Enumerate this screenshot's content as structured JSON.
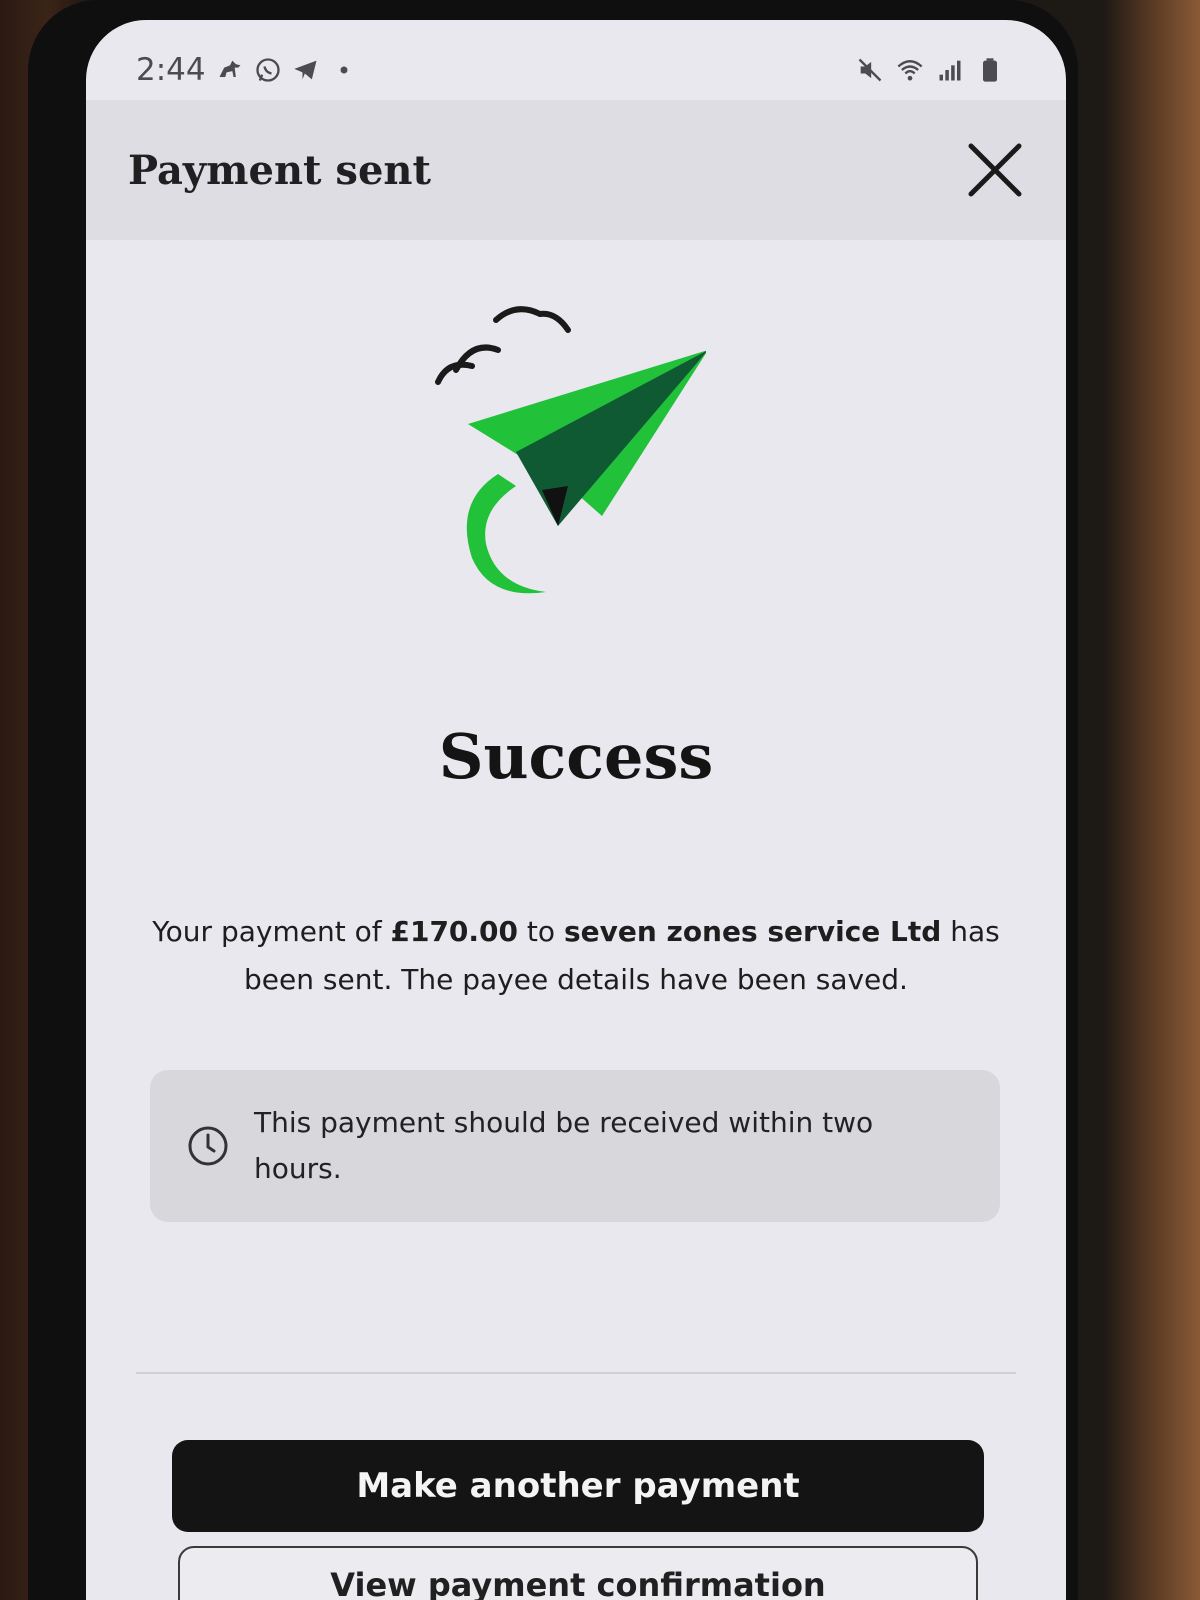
{
  "status_bar": {
    "time": "2:44",
    "left_icons": [
      "horse-icon",
      "whatsapp-icon",
      "telegram-icon",
      "dot-icon"
    ],
    "right_icons": [
      "mute-icon",
      "wifi-icon",
      "signal-icon",
      "battery-icon"
    ]
  },
  "header": {
    "title": "Payment sent",
    "close_icon": "close-icon"
  },
  "hero": {
    "icon": "paper-plane-icon",
    "colors": {
      "plane_light": "#22c13a",
      "plane_dark": "#0f5a32",
      "birds": "#1a1a1a"
    }
  },
  "success": {
    "heading": "Success",
    "message_prefix": "Your payment of ",
    "amount": "£170.00",
    "message_mid": " to ",
    "payee": "seven zones service Ltd",
    "message_suffix": " has been sent. The payee details have been saved."
  },
  "info": {
    "icon": "clock-icon",
    "text": "This payment should be received within two hours."
  },
  "actions": {
    "primary_label": "Make another payment",
    "secondary_label": "View payment confirmation"
  }
}
